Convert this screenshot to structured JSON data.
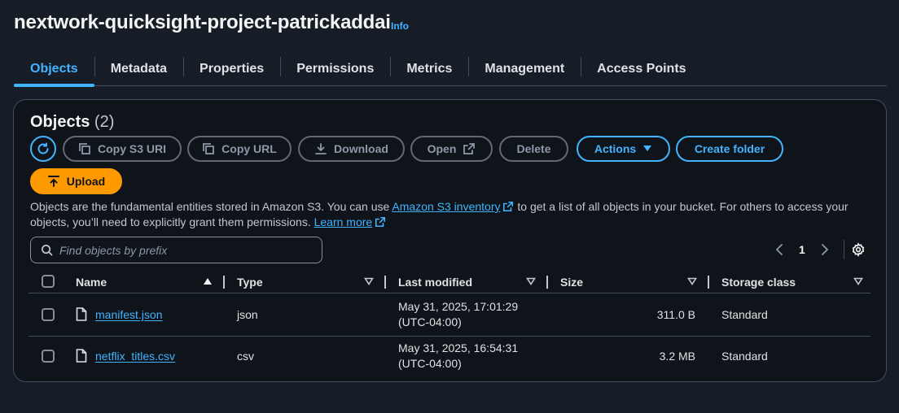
{
  "header": {
    "title": "nextwork-quicksight-project-patrickaddai",
    "info_label": "Info"
  },
  "tabs": [
    {
      "label": "Objects",
      "active": true
    },
    {
      "label": "Metadata"
    },
    {
      "label": "Properties"
    },
    {
      "label": "Permissions"
    },
    {
      "label": "Metrics"
    },
    {
      "label": "Management"
    },
    {
      "label": "Access Points"
    }
  ],
  "objects_panel": {
    "title": "Objects",
    "count": "(2)",
    "toolbar": {
      "copy_s3_uri": "Copy S3 URI",
      "copy_url": "Copy URL",
      "download": "Download",
      "open": "Open",
      "delete": "Delete",
      "actions": "Actions",
      "create_folder": "Create folder",
      "upload": "Upload"
    },
    "description": {
      "part1": "Objects are the fundamental entities stored in Amazon S3. You can use ",
      "inventory_link": "Amazon S3 inventory",
      "part2": " to get a list of all objects in your bucket. For others to access your objects, you’ll need to explicitly grant them permissions. ",
      "learn_more": "Learn more"
    },
    "search": {
      "placeholder": "Find objects by prefix"
    },
    "pagination": {
      "current_page": "1"
    },
    "columns": {
      "name": "Name",
      "type": "Type",
      "last_modified": "Last modified",
      "size": "Size",
      "storage_class": "Storage class"
    },
    "rows": [
      {
        "name": "manifest.json",
        "type": "json",
        "last_modified_line1": "May 31, 2025, 17:01:29",
        "last_modified_line2": "(UTC-04:00)",
        "size": "311.0 B",
        "storage_class": "Standard"
      },
      {
        "name": "netflix_titles.csv",
        "type": "csv",
        "last_modified_line1": "May 31, 2025, 16:54:31",
        "last_modified_line2": "(UTC-04:00)",
        "size": "3.2 MB",
        "storage_class": "Standard"
      }
    ]
  },
  "colors": {
    "background": "#161d26",
    "panel": "#0f141a",
    "accent": "#42b4ff",
    "upload": "#ff9900",
    "disabled": "#8d99a8"
  }
}
